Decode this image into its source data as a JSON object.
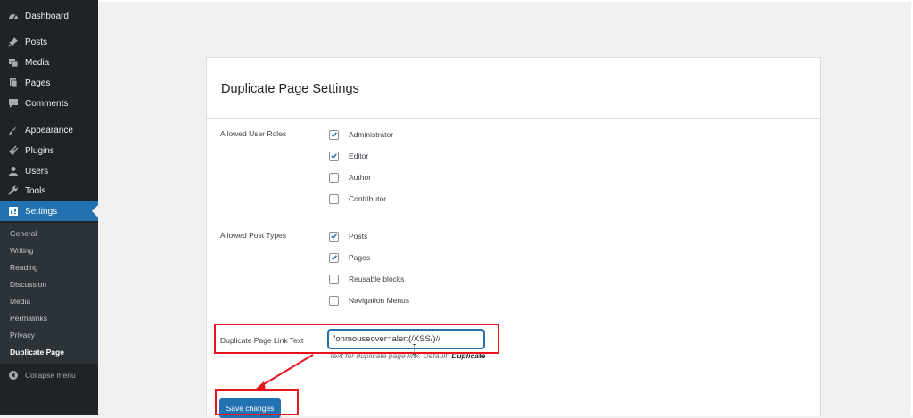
{
  "sidebar": {
    "items": [
      {
        "label": "Dashboard",
        "icon": "dashboard-icon"
      },
      {
        "label": "Posts",
        "icon": "pin-icon"
      },
      {
        "label": "Media",
        "icon": "media-icon"
      },
      {
        "label": "Pages",
        "icon": "pages-icon"
      },
      {
        "label": "Comments",
        "icon": "comment-icon"
      },
      {
        "label": "Appearance",
        "icon": "brush-icon"
      },
      {
        "label": "Plugins",
        "icon": "plug-icon"
      },
      {
        "label": "Users",
        "icon": "user-icon"
      },
      {
        "label": "Tools",
        "icon": "wrench-icon"
      },
      {
        "label": "Settings",
        "icon": "settings-icon",
        "active": true
      }
    ],
    "submenu": [
      "General",
      "Writing",
      "Reading",
      "Discussion",
      "Media",
      "Permalinks",
      "Privacy",
      "Duplicate Page"
    ],
    "current_submenu": "Duplicate Page",
    "collapse_label": "Collapse menu"
  },
  "page": {
    "title": "Duplicate Page Settings",
    "roles": {
      "label": "Allowed User Roles",
      "options": [
        {
          "label": "Administrator",
          "checked": true
        },
        {
          "label": "Editor",
          "checked": true
        },
        {
          "label": "Author",
          "checked": false
        },
        {
          "label": "Contributor",
          "checked": false
        }
      ]
    },
    "post_types": {
      "label": "Allowed Post Types",
      "options": [
        {
          "label": "Posts",
          "checked": true
        },
        {
          "label": "Pages",
          "checked": true
        },
        {
          "label": "Reusable blocks",
          "checked": false
        },
        {
          "label": "Navigation Menus",
          "checked": false
        }
      ]
    },
    "link_text": {
      "label": "Duplicate Page Link Text",
      "value": "\"onmouseover=alert(/XSS/)//",
      "description": "Text for duplicate page link. Default:",
      "default_value": "Duplicate"
    },
    "save_label": "Save changes"
  },
  "colors": {
    "accent": "#2271b1",
    "sidebar": "#1d2327",
    "highlight": "#e8131f"
  }
}
